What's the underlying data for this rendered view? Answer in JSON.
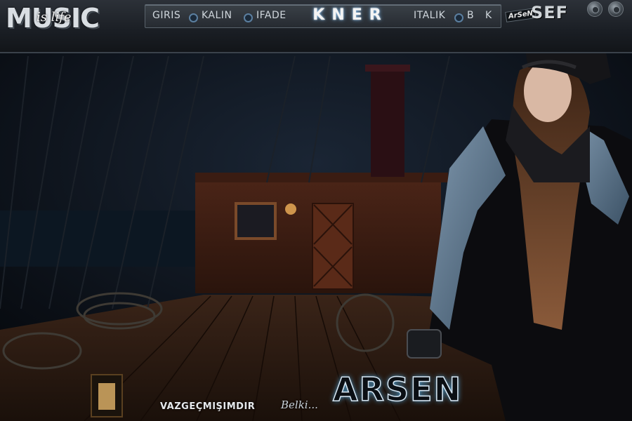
{
  "logo": {
    "main": "MUSIC",
    "accent": "is life"
  },
  "toolbar": {
    "items": [
      {
        "label": "GIRIS"
      },
      {
        "label": "KALIN"
      },
      {
        "label": "IFADE"
      },
      {
        "label": "ITALIK"
      },
      {
        "label": "B"
      },
      {
        "label": "K"
      }
    ],
    "center_title": "KNER"
  },
  "badge": {
    "small": "ArSeN",
    "big": "SEF"
  },
  "footer": {
    "text": "VAZGEÇMIŞIMDIR",
    "script": "Belki...",
    "signature": "ARSEN"
  },
  "colors": {
    "glow": "#4fa3d6",
    "bar": "#2c3138",
    "text": "#cfd6dc"
  }
}
